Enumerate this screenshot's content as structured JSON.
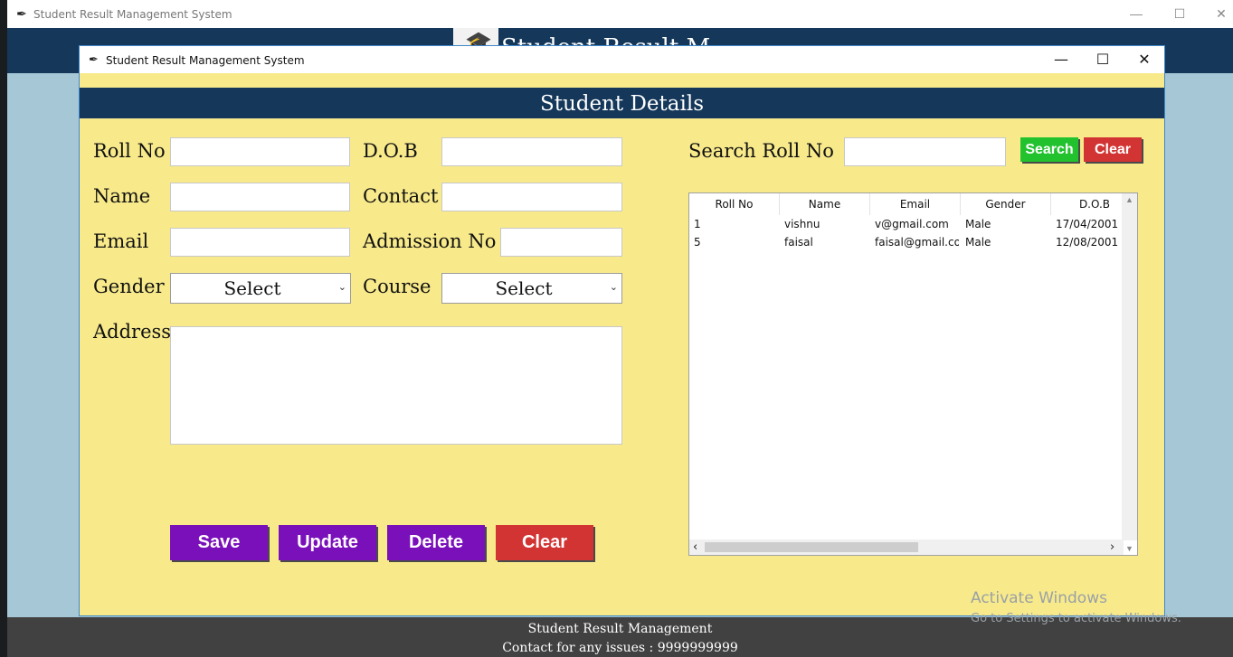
{
  "main_window": {
    "title": "Student Result Management System",
    "heading": "Student Result M",
    "footer": {
      "line1": "Student  Result Management",
      "line2": "Contact for any issues : 9999999999"
    }
  },
  "dialog": {
    "title": "Student Result Management System",
    "header": "Student Details",
    "controls": {
      "minimize": "—",
      "maximize": "☐",
      "close": "✕"
    },
    "form": {
      "roll_label": "Roll No",
      "dob_label": "D.O.B",
      "name_label": "Name",
      "contact_label": "Contact",
      "email_label": "Email",
      "admission_label": "Admission No",
      "gender_label": "Gender",
      "course_label": "Course",
      "address_label": "Address",
      "gender_value": "Select",
      "course_value": "Select"
    },
    "buttons": {
      "save": "Save",
      "update": "Update",
      "delete": "Delete",
      "clear": "Clear"
    },
    "search": {
      "label": "Search Roll No",
      "search_button": "Search",
      "clear_button": "Clear"
    },
    "table": {
      "columns": [
        "Roll No",
        "Name",
        "Email",
        "Gender",
        "D.O.B"
      ],
      "rows": [
        [
          "1",
          "vishnu",
          "v@gmail.com",
          "Male",
          "17/04/2001"
        ],
        [
          "5",
          "faisal",
          "faisal@gmail.com",
          "Male",
          "12/08/2001"
        ]
      ]
    }
  },
  "watermark": {
    "line1": "Activate Windows",
    "line2": "Go to Settings to activate Windows."
  },
  "colors": {
    "dialog_bg": "#f8ea8b",
    "header_bg": "#14375a",
    "purple_button": "#7a10ba",
    "red_button": "#d23434",
    "green_button": "#22c22f"
  }
}
